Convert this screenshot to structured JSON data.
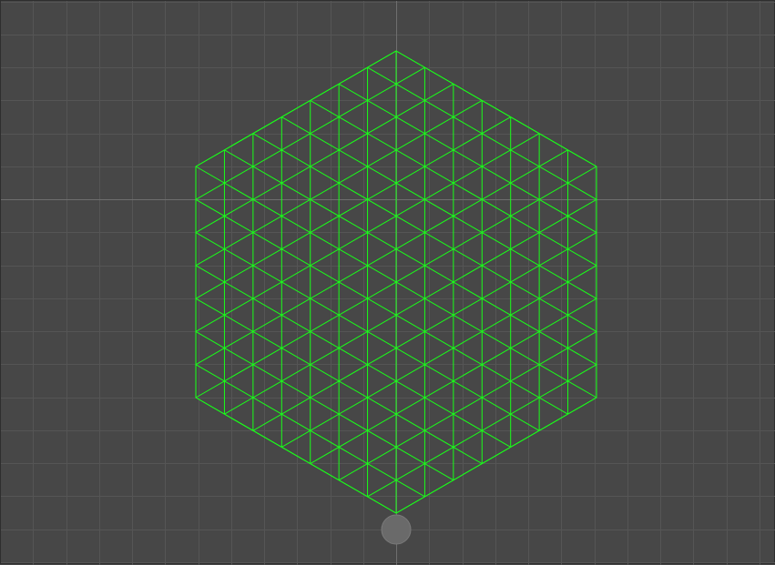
{
  "editor": {
    "view": "2d-scene-viewport",
    "background_color": "#474747",
    "grid_color": "#555555",
    "axis_color": "#6e6e6e",
    "origin_handle_color": "#6a6a6a",
    "mesh_color": "#19ff19"
  },
  "scene": {
    "objects": [
      {
        "name": "hex-triangle-grid",
        "shape": "hexagon",
        "orientation": "pointy-top",
        "subdivisions_per_edge": 7,
        "wireframe": true,
        "selected": false
      }
    ]
  }
}
